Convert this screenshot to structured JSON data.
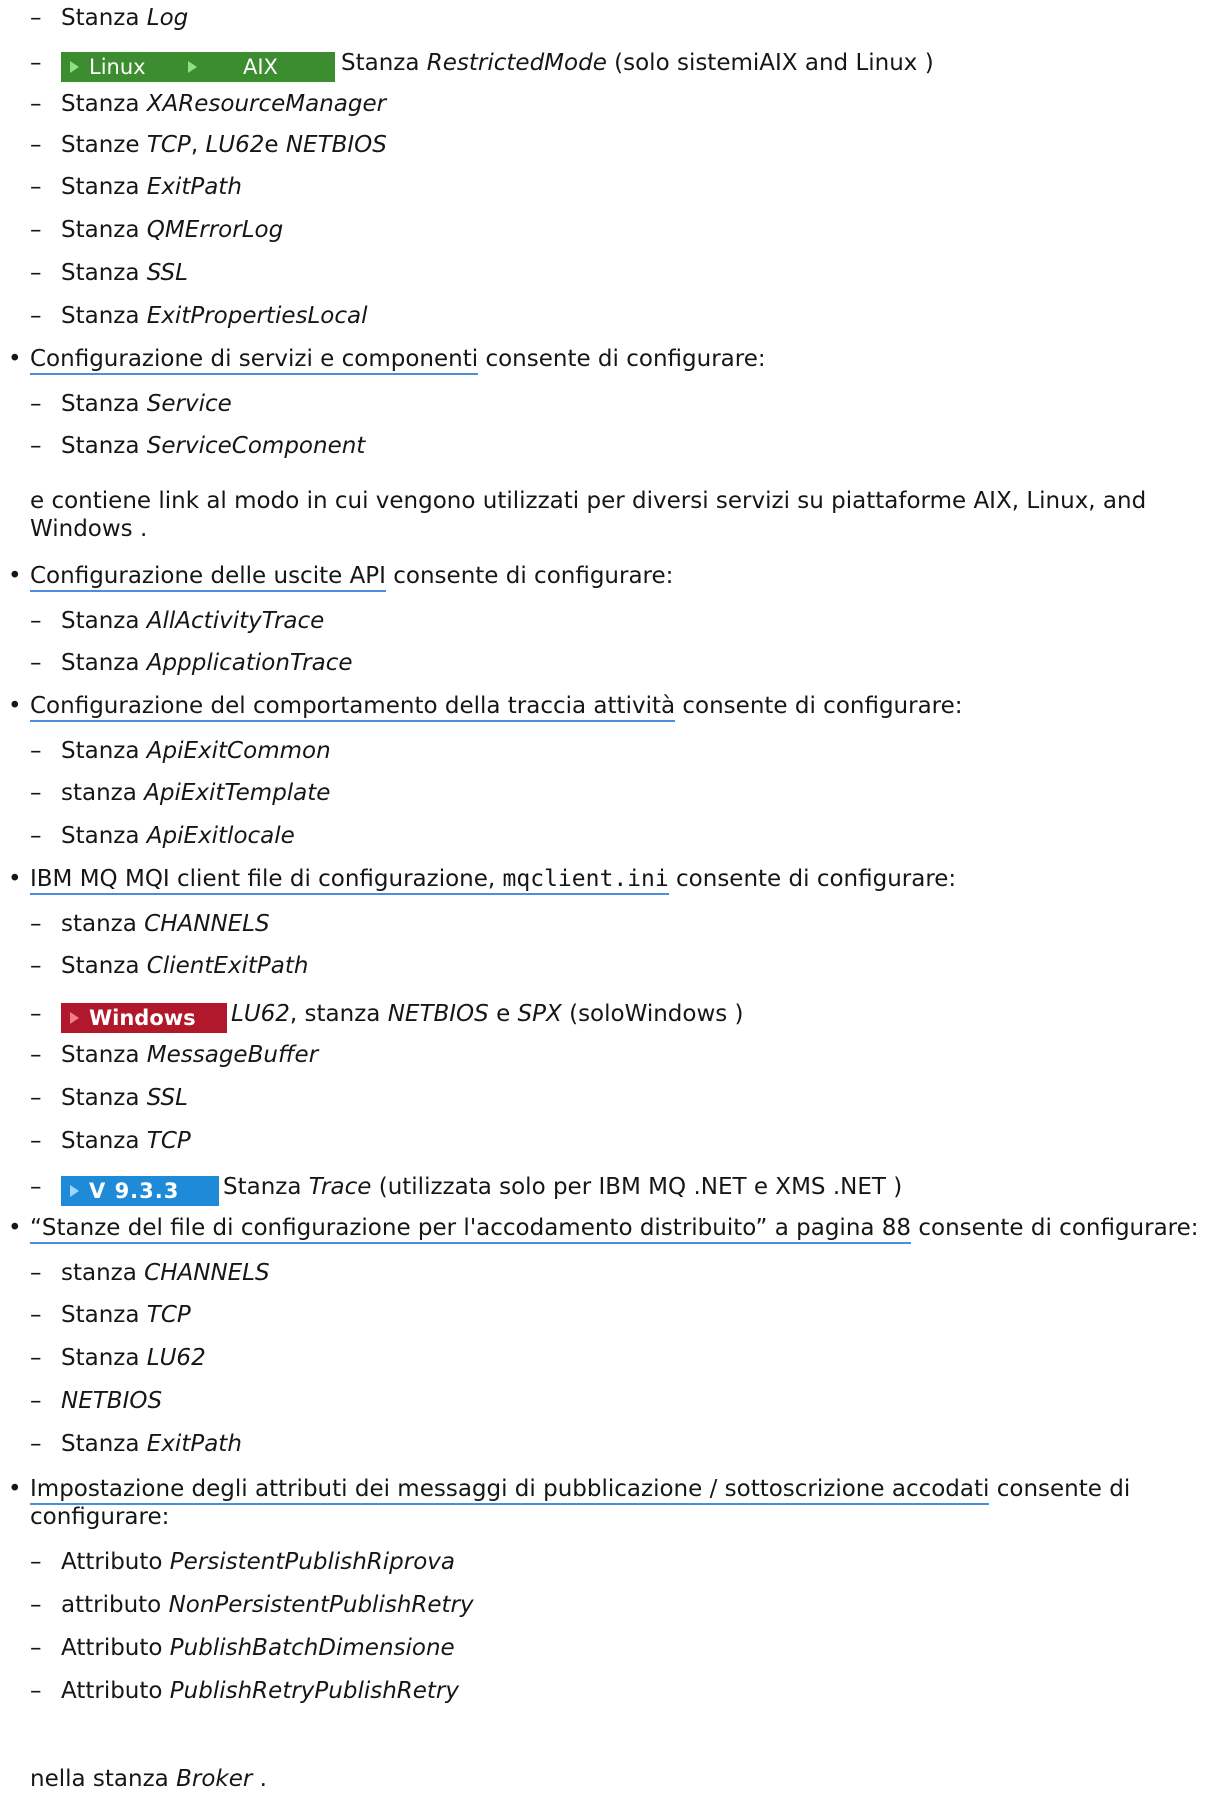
{
  "dash": "–",
  "bullet": "•",
  "lines": [
    {
      "prefix": "Stanza ",
      "em": "Log",
      "suffix": ""
    },
    {
      "badges": [
        "Linux",
        "AIX"
      ],
      "prefix": "Stanza ",
      "em": "RestrictedMode",
      "suffix": " (solo sistemiAIX and Linux )"
    },
    {
      "prefix": "Stanza ",
      "em": "XAResourceManager",
      "suffix": ""
    },
    {
      "prefix": "Stanze ",
      "em": "TCP",
      "mid": ", ",
      "em2": "LU62",
      "mid2": "e ",
      "em3": "NETBIOS",
      "suffix": ""
    },
    {
      "prefix": "Stanza ",
      "em": "ExitPath",
      "suffix": ""
    },
    {
      "prefix": "Stanza ",
      "em": "QMErrorLog",
      "suffix": ""
    },
    {
      "prefix": "Stanza ",
      "em": "SSL",
      "suffix": ""
    },
    {
      "prefix": "Stanza ",
      "em": "ExitPropertiesLocal",
      "suffix": ""
    }
  ],
  "b1": {
    "link": "Configurazione di servizi e componenti",
    "text": " consente di configurare:"
  },
  "b1_items": [
    {
      "prefix": "Stanza ",
      "em": "Service"
    },
    {
      "prefix": "Stanza ",
      "em": "ServiceComponent"
    }
  ],
  "b1_para_1": "e contiene link al modo in cui vengono utilizzati per diversi servizi su piattaforme AIX, Linux, and",
  "b1_para_2": "Windows .",
  "b2": {
    "link": "Configurazione delle uscite API",
    "text": " consente di configurare:"
  },
  "b2_items": [
    {
      "prefix": "Stanza ",
      "em": "AllActivityTrace"
    },
    {
      "prefix": "Stanza ",
      "em": "AppplicationTrace"
    }
  ],
  "b3": {
    "link": "Configurazione del comportamento della traccia attività",
    "text": " consente di configurare:"
  },
  "b3_items": [
    {
      "prefix": "Stanza ",
      "em": "ApiExitCommon"
    },
    {
      "prefix": "stanza ",
      "em": "ApiExitTemplate"
    },
    {
      "prefix": "Stanza ",
      "em": "ApiExitlocale"
    }
  ],
  "b4": {
    "link_a": "IBM MQ MQI client file di configurazione, ",
    "link_code": "mqclient.ini",
    "text": " consente di configurare:"
  },
  "b4_items": [
    {
      "prefix": "stanza ",
      "em": "CHANNELS",
      "suffix": ""
    },
    {
      "prefix": "Stanza ",
      "em": "ClientExitPath",
      "suffix": ""
    },
    {
      "badge": "Windows",
      "em": "LU62",
      "mid": ", stanza ",
      "em2": "NETBIOS",
      "mid2": " e ",
      "em3": "SPX",
      "suffix": " (soloWindows )"
    },
    {
      "prefix": "Stanza ",
      "em": "MessageBuffer",
      "suffix": ""
    },
    {
      "prefix": "Stanza ",
      "em": "SSL",
      "suffix": ""
    },
    {
      "prefix": "Stanza ",
      "em": "TCP",
      "suffix": ""
    },
    {
      "badge": "V 9.3.3",
      "prefix": "Stanza ",
      "em": "Trace",
      "suffix": " (utilizzata solo per IBM MQ .NET e XMS .NET )"
    }
  ],
  "b5": {
    "link": "“Stanze del file di configurazione per l'accodamento distribuito” a pagina 88",
    "text": " consente di configurare:"
  },
  "b5_items": [
    {
      "prefix": "stanza ",
      "em": "CHANNELS"
    },
    {
      "prefix": "Stanza ",
      "em": "TCP"
    },
    {
      "prefix": "Stanza ",
      "em": "LU62"
    },
    {
      "prefix": "",
      "em": "NETBIOS"
    },
    {
      "prefix": "Stanza ",
      "em": "ExitPath"
    }
  ],
  "b6": {
    "link": "Impostazione degli attributi dei messaggi di pubblicazione / sottoscrizione accodati",
    "text": " consente di",
    "text2": "configurare:"
  },
  "b6_items": [
    {
      "prefix": "Attributo ",
      "em": "PersistentPublishRiprova"
    },
    {
      "prefix": "attributo ",
      "em": "NonPersistentPublishRetry"
    },
    {
      "prefix": "Attributo ",
      "em": "PublishBatchDimensione"
    },
    {
      "prefix": "Attributo ",
      "em": "PublishRetryPublishRetry"
    }
  ],
  "final": {
    "prefix": "nella stanza ",
    "em": "Broker",
    "suffix": " ."
  }
}
